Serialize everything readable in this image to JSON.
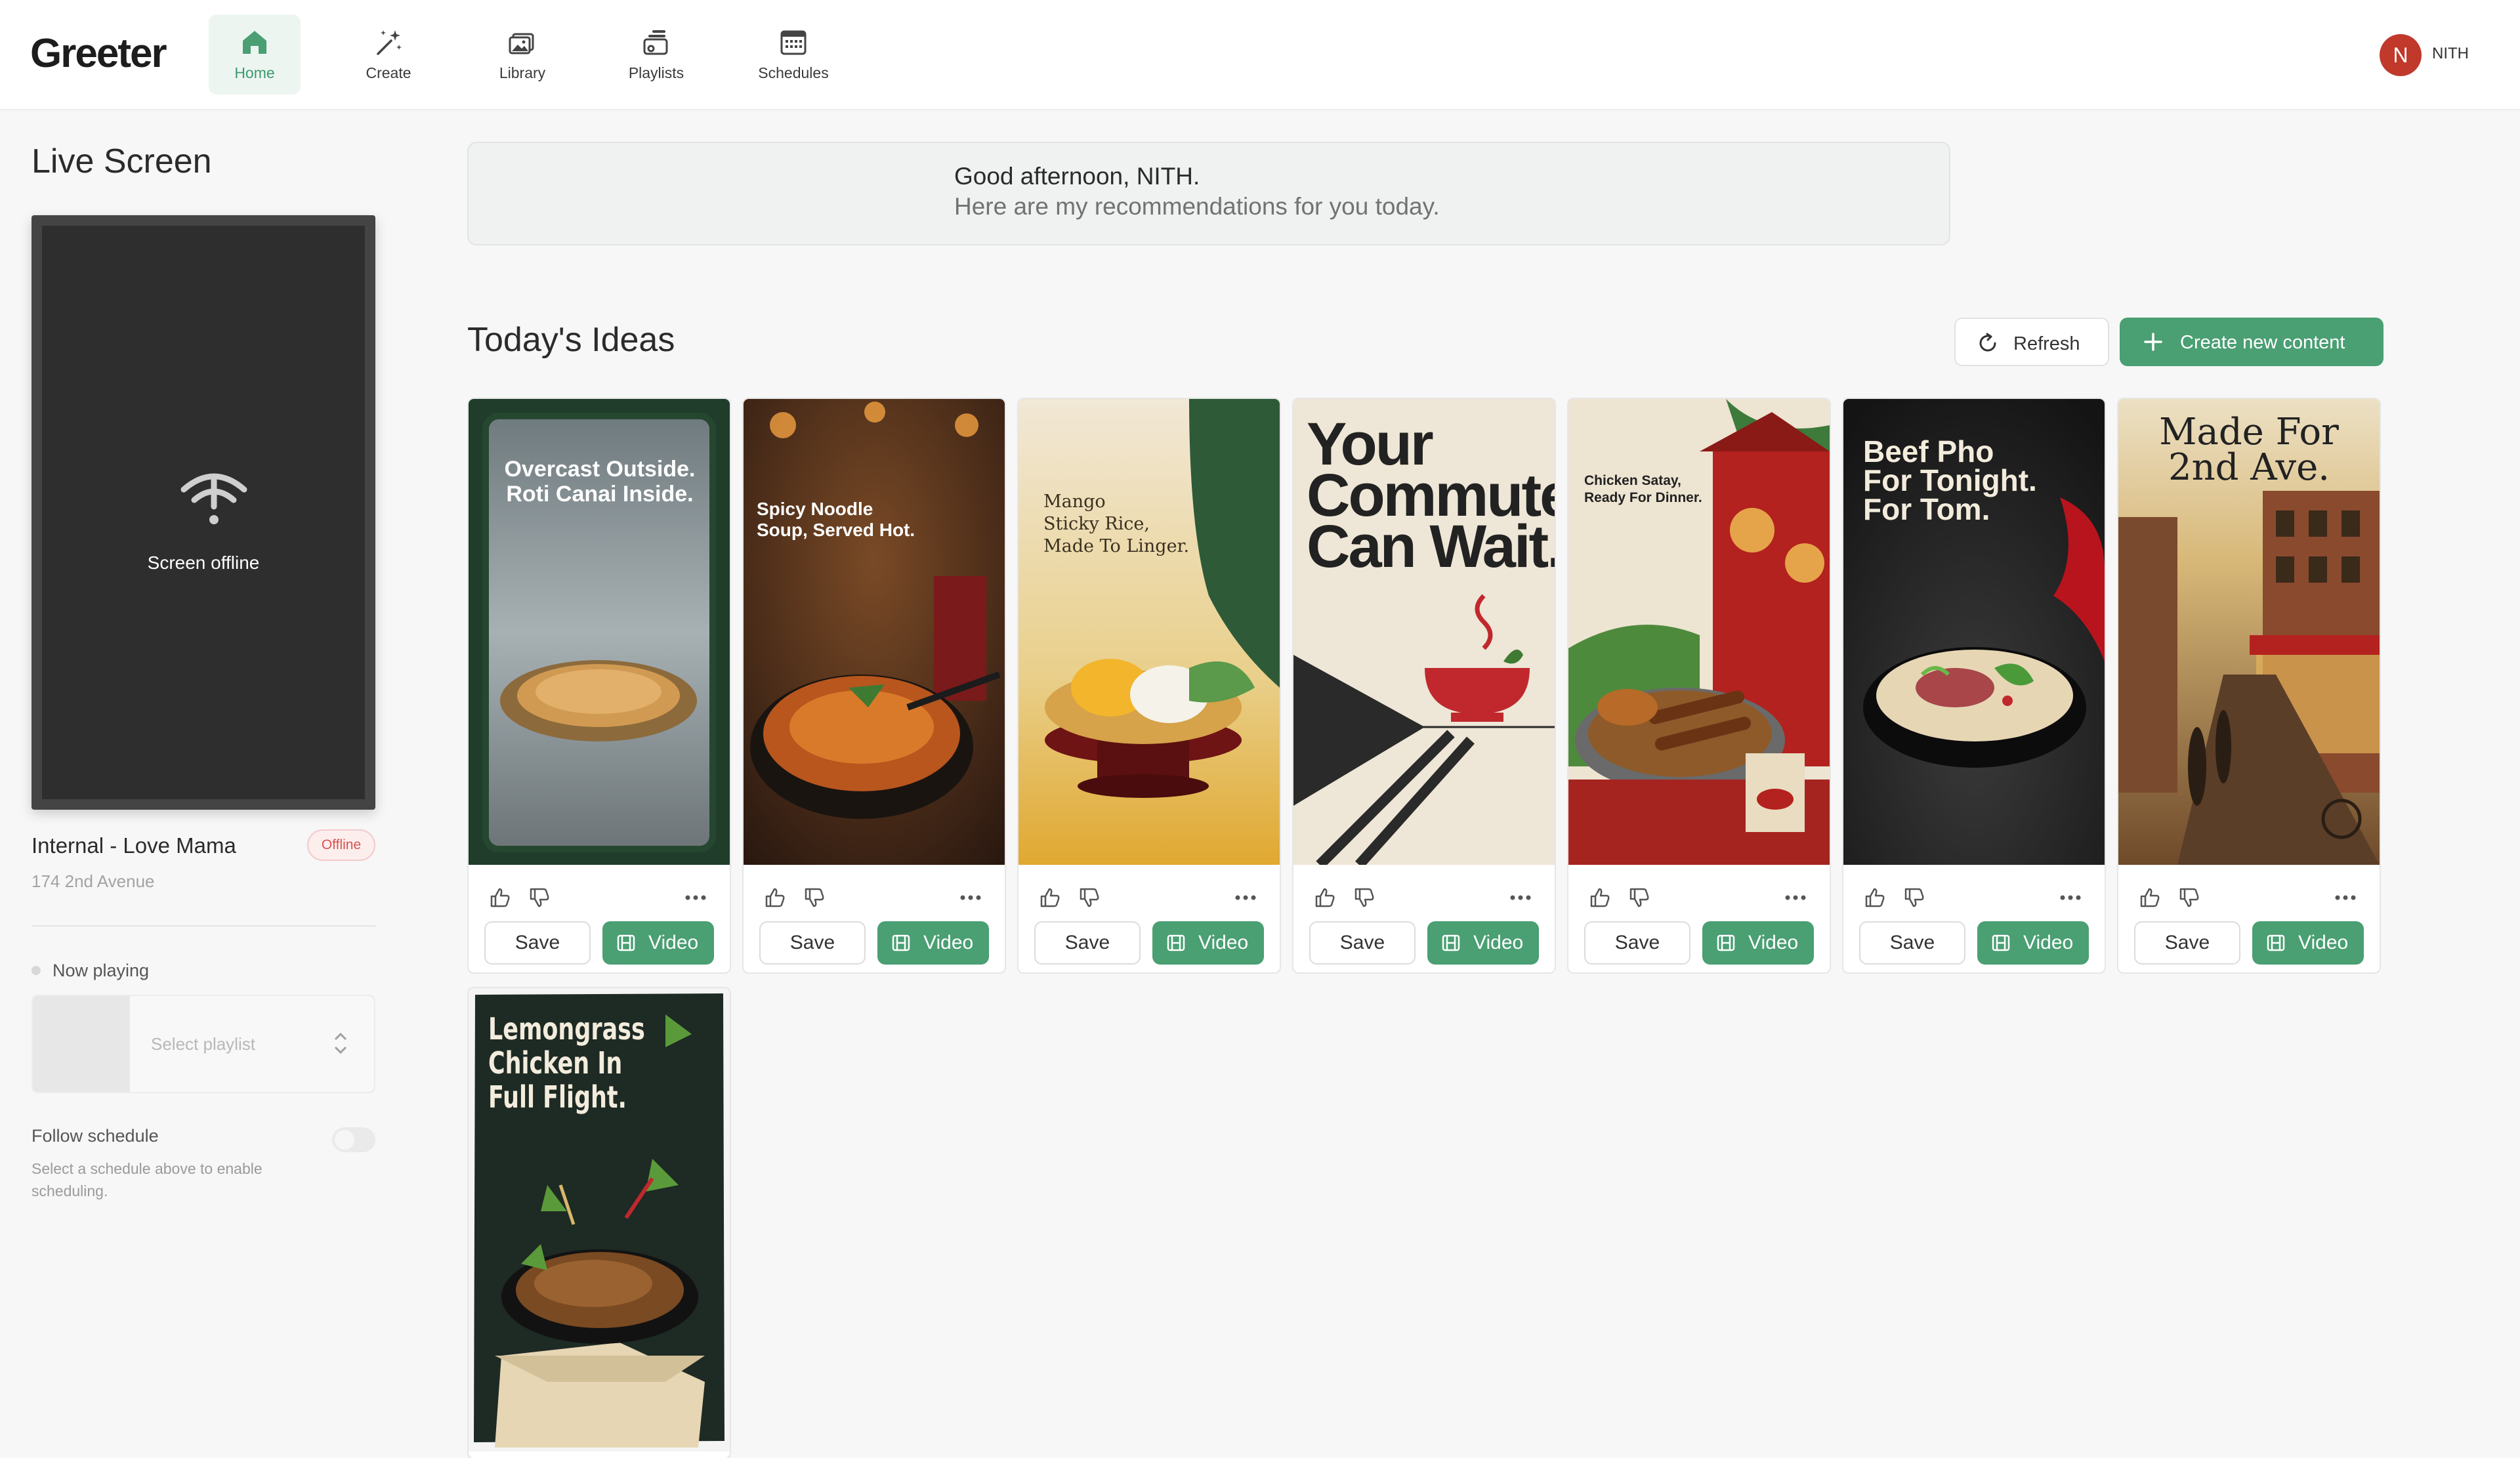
{
  "app": {
    "name": "Greeter"
  },
  "nav": {
    "items": [
      {
        "label": "Home",
        "icon": "home-icon",
        "active": true
      },
      {
        "label": "Create",
        "icon": "magic-wand-icon",
        "active": false
      },
      {
        "label": "Library",
        "icon": "image-library-icon",
        "active": false
      },
      {
        "label": "Playlists",
        "icon": "playlists-icon",
        "active": false
      },
      {
        "label": "Schedules",
        "icon": "calendar-icon",
        "active": false
      }
    ]
  },
  "user": {
    "initial": "N",
    "name": "NITH",
    "avatar_color": "#c0392b"
  },
  "live_screen": {
    "title": "Live Screen",
    "screen_status": "Screen offline",
    "location_name": "Internal - Love Mama",
    "status_badge": "Offline",
    "address": "174 2nd Avenue",
    "now_playing_label": "Now playing",
    "playlist_placeholder": "Select playlist",
    "follow_schedule_label": "Follow schedule",
    "follow_schedule_enabled": false,
    "follow_schedule_hint": "Select a schedule above to enable scheduling."
  },
  "greeting": {
    "line1": "Good afternoon, NITH.",
    "line2": "Here are my recommendations for you today."
  },
  "ideas": {
    "title": "Today's Ideas",
    "refresh_label": "Refresh",
    "create_label": "Create new content",
    "save_label": "Save",
    "video_label": "Video",
    "cards": [
      {
        "headline": "Overcast Outside.\nRoti Canai Inside."
      },
      {
        "headline": "Spicy Noodle\nSoup, Served Hot."
      },
      {
        "headline": "Mango\nSticky Rice,\nMade To Linger."
      },
      {
        "headline": "Your\nCommute\nCan Wait."
      },
      {
        "headline": "Chicken Satay,\nReady For Dinner."
      },
      {
        "headline": "Beef Pho\nFor Tonight.\nFor Tom."
      },
      {
        "headline": "Made For\n2nd Ave."
      },
      {
        "headline": "Lemongrass\nChicken In\nFull Flight."
      }
    ]
  },
  "colors": {
    "accent": "#4a9f73",
    "offline": "#d9534f"
  }
}
